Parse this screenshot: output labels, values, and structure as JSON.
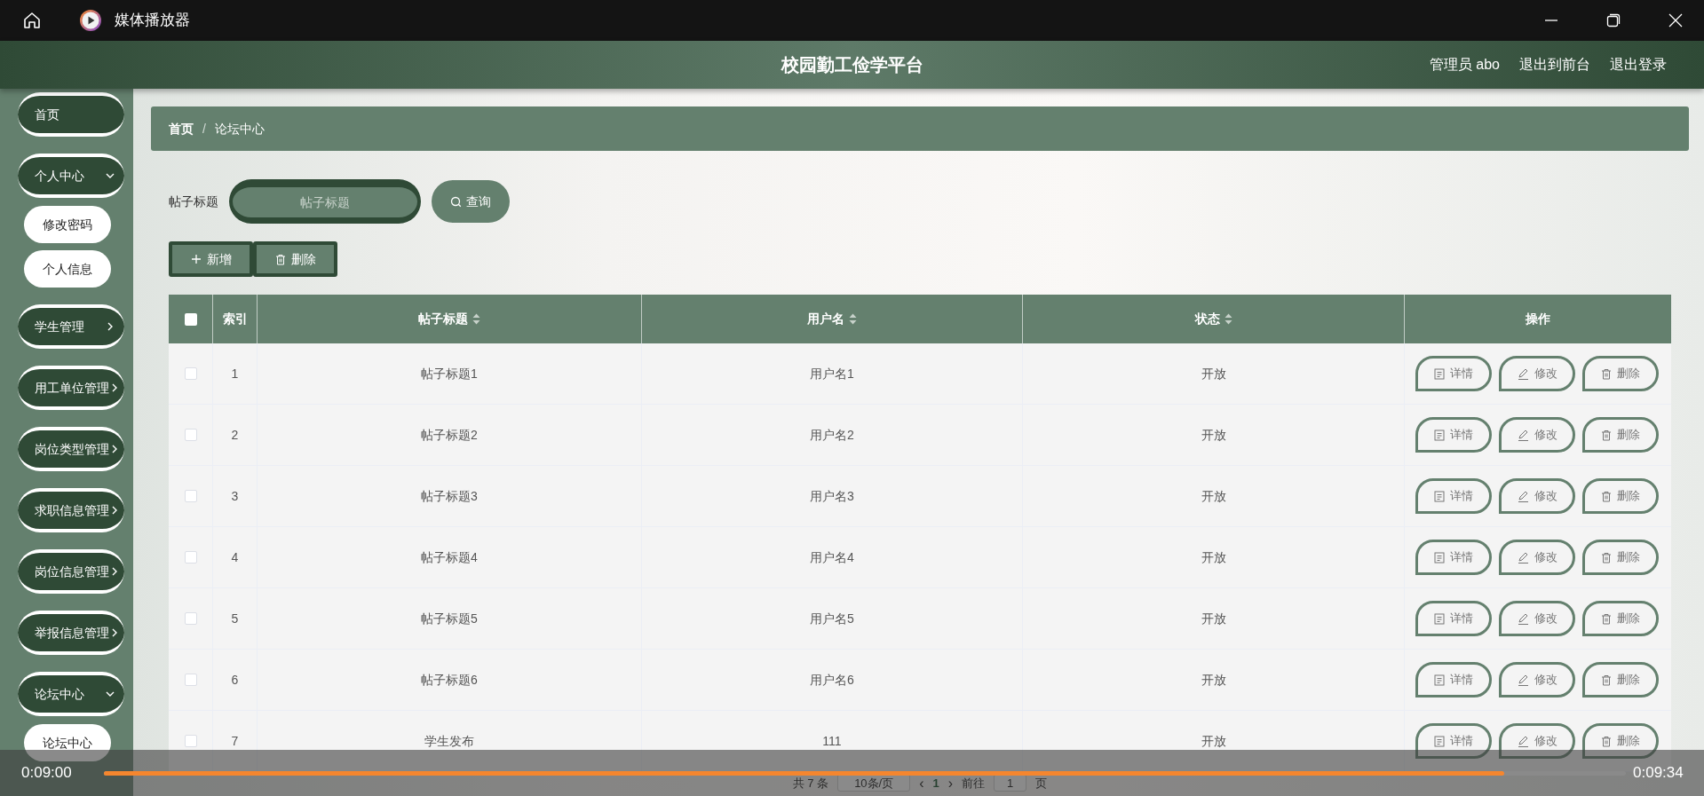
{
  "window": {
    "title": "媒体播放器"
  },
  "header": {
    "title": "校园勤工俭学平台",
    "links": [
      "管理员 abo",
      "退出到前台",
      "退出登录"
    ]
  },
  "sidebar": {
    "items": [
      {
        "label": "首页"
      },
      {
        "label": "个人中心",
        "expanded": true,
        "children": [
          {
            "label": "修改密码"
          },
          {
            "label": "个人信息"
          }
        ]
      },
      {
        "label": "学生管理",
        "expanded": false
      },
      {
        "label": "用工单位管理",
        "expanded": false
      },
      {
        "label": "岗位类型管理",
        "expanded": false
      },
      {
        "label": "求职信息管理",
        "expanded": false
      },
      {
        "label": "岗位信息管理",
        "expanded": false
      },
      {
        "label": "举报信息管理",
        "expanded": false
      },
      {
        "label": "论坛中心",
        "expanded": true,
        "children": [
          {
            "label": "论坛中心"
          }
        ]
      }
    ]
  },
  "breadcrumb": {
    "separator": "/",
    "items": [
      "首页",
      "论坛中心"
    ]
  },
  "search": {
    "label": "帖子标题",
    "placeholder": "帖子标题",
    "button": "查询"
  },
  "actions": [
    {
      "kind": "add",
      "label": "新增"
    },
    {
      "kind": "delete",
      "label": "删除"
    }
  ],
  "table": {
    "select_all_checked": false,
    "columns": [
      {
        "label": "索引",
        "sortable": false
      },
      {
        "label": "帖子标题",
        "sortable": true
      },
      {
        "label": "用户名",
        "sortable": true
      },
      {
        "label": "状态",
        "sortable": true
      },
      {
        "label": "操作",
        "sortable": false
      }
    ],
    "rows": [
      {
        "checked": false,
        "index": "1",
        "title": "帖子标题1",
        "user": "用户名1",
        "status": "开放",
        "actions": [
          {
            "kind": "detail",
            "label": "详情"
          },
          {
            "kind": "edit",
            "label": "修改"
          },
          {
            "kind": "delete",
            "label": "删除"
          }
        ]
      },
      {
        "checked": false,
        "index": "2",
        "title": "帖子标题2",
        "user": "用户名2",
        "status": "开放",
        "actions": [
          {
            "kind": "detail",
            "label": "详情"
          },
          {
            "kind": "edit",
            "label": "修改"
          },
          {
            "kind": "delete",
            "label": "删除"
          }
        ]
      },
      {
        "checked": false,
        "index": "3",
        "title": "帖子标题3",
        "user": "用户名3",
        "status": "开放",
        "actions": [
          {
            "kind": "detail",
            "label": "详情"
          },
          {
            "kind": "edit",
            "label": "修改"
          },
          {
            "kind": "delete",
            "label": "删除"
          }
        ]
      },
      {
        "checked": false,
        "index": "4",
        "title": "帖子标题4",
        "user": "用户名4",
        "status": "开放",
        "actions": [
          {
            "kind": "detail",
            "label": "详情"
          },
          {
            "kind": "edit",
            "label": "修改"
          },
          {
            "kind": "delete",
            "label": "删除"
          }
        ]
      },
      {
        "checked": false,
        "index": "5",
        "title": "帖子标题5",
        "user": "用户名5",
        "status": "开放",
        "actions": [
          {
            "kind": "detail",
            "label": "详情"
          },
          {
            "kind": "edit",
            "label": "修改"
          },
          {
            "kind": "delete",
            "label": "删除"
          }
        ]
      },
      {
        "checked": false,
        "index": "6",
        "title": "帖子标题6",
        "user": "用户名6",
        "status": "开放",
        "actions": [
          {
            "kind": "detail",
            "label": "详情"
          },
          {
            "kind": "edit",
            "label": "修改"
          },
          {
            "kind": "delete",
            "label": "删除"
          }
        ]
      },
      {
        "checked": false,
        "index": "7",
        "title": "学生发布",
        "user": "111",
        "status": "开放",
        "actions": [
          {
            "kind": "detail",
            "label": "详情"
          },
          {
            "kind": "edit",
            "label": "修改"
          },
          {
            "kind": "delete",
            "label": "删除"
          }
        ]
      }
    ]
  },
  "pagination": {
    "total": "共 7 条",
    "page_size": "10条/页",
    "prev": "‹",
    "next": "›",
    "pages": [
      {
        "label": "1",
        "selected": true
      }
    ],
    "goto": "前往",
    "goto_value": "1",
    "suffix": "页"
  },
  "player": {
    "elapsed": "0:09:00",
    "duration": "0:09:34",
    "level": 0.92
  }
}
